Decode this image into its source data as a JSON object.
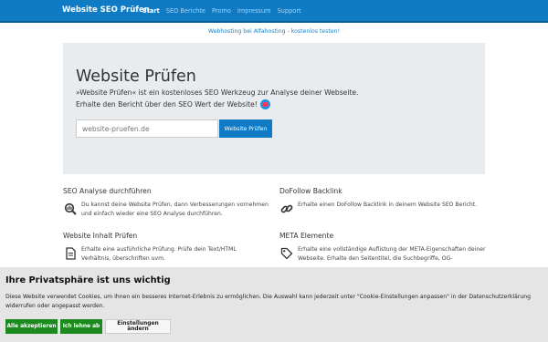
{
  "navbar": {
    "brand": "Website SEO Prüfen",
    "links": [
      "Start",
      "SEO Berichte",
      "Promo",
      "Impressum",
      "Support"
    ]
  },
  "ad": {
    "text": "Webhosting bei Alfahosting - kostenlos testen!"
  },
  "jumbotron": {
    "title": "Website Prüfen",
    "lead1": "»Website Prüfen« ist ein kostenloses SEO Werkzeug zur Analyse deiner Webseite.",
    "lead2": "Erhalte den Bericht über den SEO Wert der Website!",
    "input_placeholder": "website-pruefen.de",
    "button_label": "Website Prüfen"
  },
  "features": [
    {
      "title": "SEO Analyse durchführen",
      "icon": "seo-analysis-icon",
      "text": "Du kannst deine Website Prüfen, dann Verbesserungen vornehmen und einfach wieder eine SEO Analyse durchführen."
    },
    {
      "title": "DoFollow Backlink",
      "icon": "link-icon",
      "text": "Erhalte einen DoFollow Backlink in deinem Website SEO Bericht."
    },
    {
      "title": "Website Inhalt Prüfen",
      "icon": "document-icon",
      "text": "Erhalte eine ausführliche Prüfung. Prüfe dein Text/HTML Verhältnis, überschriften uvm."
    },
    {
      "title": "META Elemente",
      "icon": "tag-icon",
      "text": "Erhalte eine vollständige Auflistung der META-Eigenschaften deiner Webseite. Erhalte den Seitentitel, die Suchbegriffe, OG-"
    }
  ],
  "cookie": {
    "title": "Ihre Privatsphäre ist uns wichtig",
    "text": "Diese Website verwendet Cookies, um Ihnen ein besseres Internet-Erlebnis zu ermöglichen. Die Auswahl kann jederzeit unter \"Cookie-Einstellungen anpassen\" in der Datenschutzerklärung widerrufen oder angepasst werden.",
    "accept_label": "Alle akzeptieren",
    "reject_label": "Ich lehne ab",
    "settings_label": "Einstellungen ändern"
  },
  "colors": {
    "brand": "#0f7bc4",
    "jumbotron_bg": "#e9ecef",
    "accept_green": "#1c8a1f"
  }
}
